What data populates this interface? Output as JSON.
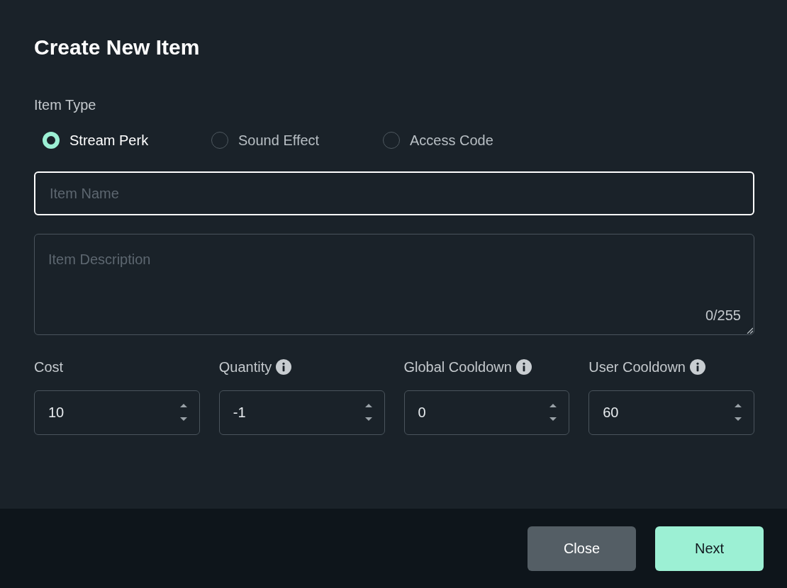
{
  "dialog": {
    "title": "Create New Item"
  },
  "item_type": {
    "label": "Item Type",
    "options": [
      {
        "label": "Stream Perk",
        "selected": true
      },
      {
        "label": "Sound Effect",
        "selected": false
      },
      {
        "label": "Access Code",
        "selected": false
      }
    ]
  },
  "name_field": {
    "placeholder": "Item Name",
    "focused": true
  },
  "description_field": {
    "placeholder": "Item Description",
    "counter": "0/255"
  },
  "number_fields": [
    {
      "label": "Cost",
      "info": false,
      "value": "10"
    },
    {
      "label": "Quantity",
      "info": true,
      "value": "-1"
    },
    {
      "label": "Global Cooldown",
      "info": true,
      "value": "0"
    },
    {
      "label": "User Cooldown",
      "info": true,
      "value": "60"
    }
  ],
  "buttons": [
    {
      "label": "Close",
      "kind": "secondary"
    },
    {
      "label": "Next",
      "kind": "primary"
    }
  ]
}
